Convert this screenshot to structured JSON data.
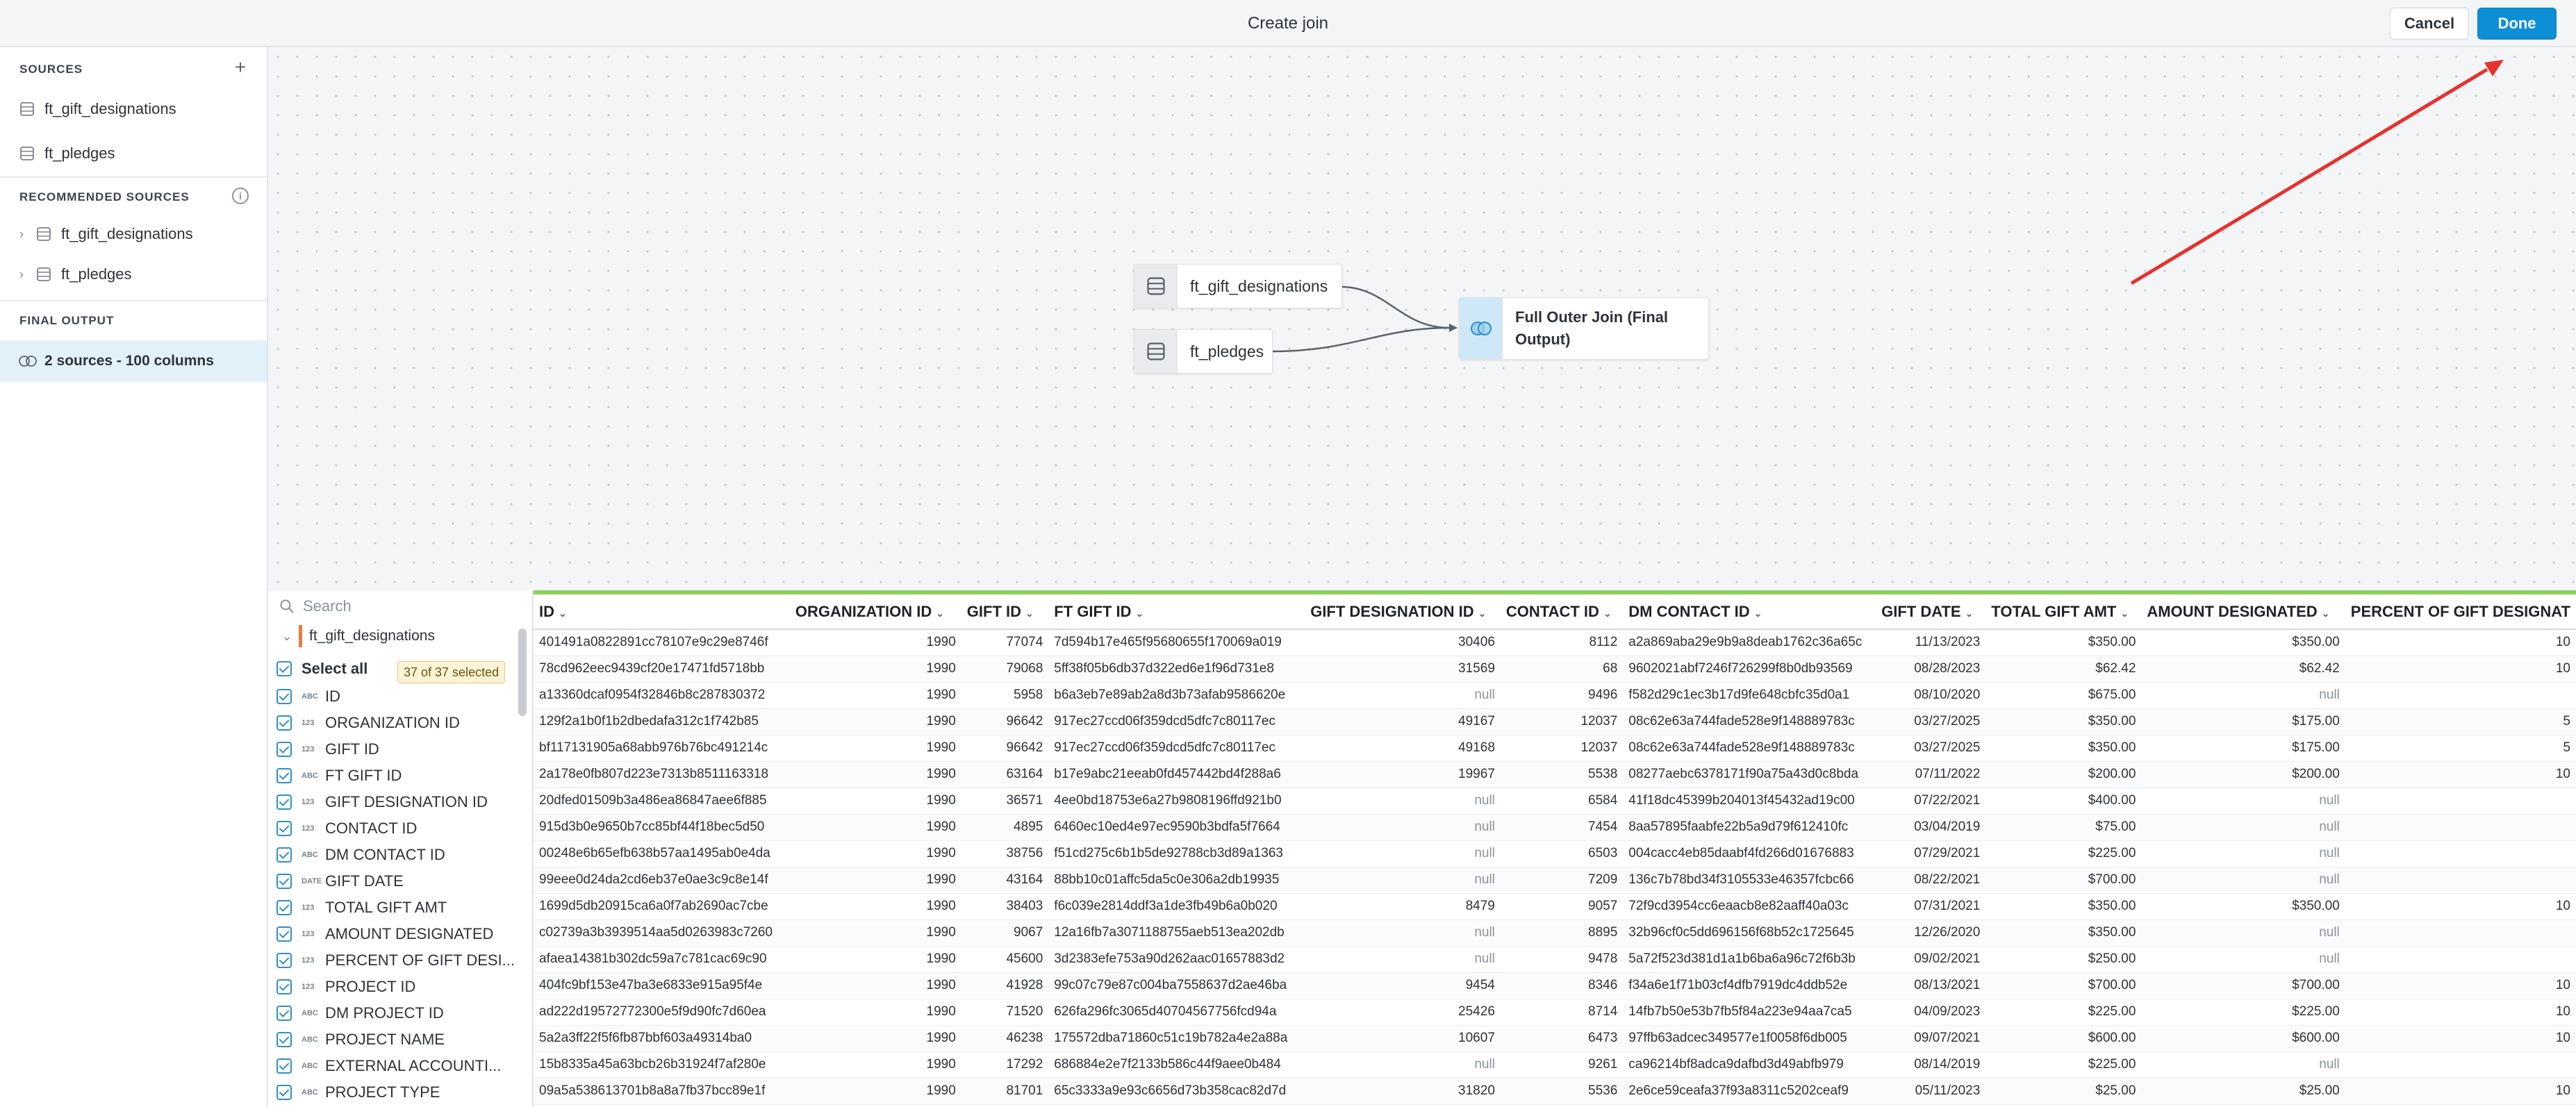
{
  "header": {
    "title": "Create join",
    "cancel_label": "Cancel",
    "done_label": "Done"
  },
  "sidebar": {
    "sources_heading": "SOURCES",
    "sources": [
      "ft_gift_designations",
      "ft_pledges"
    ],
    "recommended_heading": "RECOMMENDED SOURCES",
    "recommended": [
      "ft_gift_designations",
      "ft_pledges"
    ],
    "final_heading": "FINAL OUTPUT",
    "final_item": "2 sources - 100 columns"
  },
  "canvas": {
    "node1": "ft_gift_designations",
    "node2": "ft_pledges",
    "join_line1": "Full Outer Join (Final",
    "join_line2": "Output)"
  },
  "fields": {
    "search_placeholder": "Search",
    "source_name": "ft_gift_designations",
    "select_all": "Select all",
    "selected_badge": "37 of 37 selected",
    "items": [
      {
        "type": "ABC",
        "name": "ID"
      },
      {
        "type": "123",
        "name": "ORGANIZATION ID"
      },
      {
        "type": "123",
        "name": "GIFT ID"
      },
      {
        "type": "ABC",
        "name": "FT GIFT ID"
      },
      {
        "type": "123",
        "name": "GIFT DESIGNATION ID"
      },
      {
        "type": "123",
        "name": "CONTACT ID"
      },
      {
        "type": "ABC",
        "name": "DM CONTACT ID"
      },
      {
        "type": "DATE",
        "name": "GIFT DATE"
      },
      {
        "type": "123",
        "name": "TOTAL GIFT AMT"
      },
      {
        "type": "123",
        "name": "AMOUNT DESIGNATED"
      },
      {
        "type": "123",
        "name": "PERCENT OF GIFT DESI..."
      },
      {
        "type": "123",
        "name": "PROJECT ID"
      },
      {
        "type": "ABC",
        "name": "DM PROJECT ID"
      },
      {
        "type": "ABC",
        "name": "PROJECT NAME"
      },
      {
        "type": "ABC",
        "name": "EXTERNAL ACCOUNTI..."
      },
      {
        "type": "ABC",
        "name": "PROJECT TYPE"
      }
    ]
  },
  "table": {
    "columns": [
      "ID",
      "ORGANIZATION ID",
      "GIFT ID",
      "FT GIFT ID",
      "GIFT DESIGNATION ID",
      "CONTACT ID",
      "DM CONTACT ID",
      "GIFT DATE",
      "TOTAL GIFT AMT",
      "AMOUNT DESIGNATED",
      "PERCENT OF GIFT DESIGNAT"
    ],
    "rows": [
      [
        "401491a0822891cc78107e9c29e8746f",
        "1990",
        "77074",
        "7d594b17e465f95680655f170069a019",
        "30406",
        "8112",
        "a2a869aba29e9b9a8deab1762c36a65c",
        "11/13/2023",
        "$350.00",
        "$350.00",
        "10"
      ],
      [
        "78cd962eec9439cf20e17471fd5718bb",
        "1990",
        "79068",
        "5ff38f05b6db37d322ed6e1f96d731e8",
        "31569",
        "68",
        "9602021abf7246f726299f8b0db93569",
        "08/28/2023",
        "$62.42",
        "$62.42",
        "10"
      ],
      [
        "a13360dcaf0954f32846b8c287830372",
        "1990",
        "5958",
        "b6a3eb7e89ab2a8d3b73afab9586620e",
        "null",
        "9496",
        "f582d29c1ec3b17d9fe648cbfc35d0a1",
        "08/10/2020",
        "$675.00",
        "null",
        ""
      ],
      [
        "129f2a1b0f1b2dbedafa312c1f742b85",
        "1990",
        "96642",
        "917ec27ccd06f359dcd5dfc7c80117ec",
        "49167",
        "12037",
        "08c62e63a744fade528e9f148889783c",
        "03/27/2025",
        "$350.00",
        "$175.00",
        "5"
      ],
      [
        "bf117131905a68abb976b76bc491214c",
        "1990",
        "96642",
        "917ec27ccd06f359dcd5dfc7c80117ec",
        "49168",
        "12037",
        "08c62e63a744fade528e9f148889783c",
        "03/27/2025",
        "$350.00",
        "$175.00",
        "5"
      ],
      [
        "2a178e0fb807d223e7313b8511163318",
        "1990",
        "63164",
        "b17e9abc21eeab0fd457442bd4f288a6",
        "19967",
        "5538",
        "08277aebc6378171f90a75a43d0c8bda",
        "07/11/2022",
        "$200.00",
        "$200.00",
        "10"
      ],
      [
        "20dfed01509b3a486ea86847aee6f885",
        "1990",
        "36571",
        "4ee0bd18753e6a27b9808196ffd921b0",
        "null",
        "6584",
        "41f18dc45399b204013f45432ad19c00",
        "07/22/2021",
        "$400.00",
        "null",
        ""
      ],
      [
        "915d3b0e9650b7cc85bf44f18bec5d50",
        "1990",
        "4895",
        "6460ec10ed4e97ec9590b3bdfa5f7664",
        "null",
        "7454",
        "8aa57895faabfe22b5a9d79f612410fc",
        "03/04/2019",
        "$75.00",
        "null",
        ""
      ],
      [
        "00248e6b65efb638b57aa1495ab0e4da",
        "1990",
        "38756",
        "f51cd275c6b1b5de92788cb3d89a1363",
        "null",
        "6503",
        "004cacc4eb85daabf4fd266d01676883",
        "07/29/2021",
        "$225.00",
        "null",
        ""
      ],
      [
        "99eee0d24da2cd6eb37e0ae3c9c8e14f",
        "1990",
        "43164",
        "88bb10c01affc5da5c0e306a2db19935",
        "null",
        "7209",
        "136c7b78bd34f3105533e46357fcbc66",
        "08/22/2021",
        "$700.00",
        "null",
        ""
      ],
      [
        "1699d5db20915ca6a0f7ab2690ac7cbe",
        "1990",
        "38403",
        "f6c039e2814ddf3a1de3fb49b6a0b020",
        "8479",
        "9057",
        "72f9cd3954cc6eaacb8e82aaff40a03c",
        "07/31/2021",
        "$350.00",
        "$350.00",
        "10"
      ],
      [
        "c02739a3b3939514aa5d0263983c7260",
        "1990",
        "9067",
        "12a16fb7a3071188755aeb513ea202db",
        "null",
        "8895",
        "32b96cf0c5dd696156f68b52c1725645",
        "12/26/2020",
        "$350.00",
        "null",
        ""
      ],
      [
        "afaea14381b302dc59a7c781cac69c90",
        "1990",
        "45600",
        "3d2383efe753a90d262aac01657883d2",
        "null",
        "9478",
        "5a72f523d381d1a1b6ba6a96c72f6b3b",
        "09/02/2021",
        "$250.00",
        "null",
        ""
      ],
      [
        "404fc9bf153e47ba3e6833e915a95f4e",
        "1990",
        "41928",
        "99c07c79e87c004ba7558637d2ae46ba",
        "9454",
        "8346",
        "f34a6e1f71b03cf4dfb7919dc4ddb52e",
        "08/13/2021",
        "$700.00",
        "$700.00",
        "10"
      ],
      [
        "ad222d19572772300e5f9d90fc7d60ea",
        "1990",
        "71520",
        "626fa296fc3065d40704567756fcd94a",
        "25426",
        "8714",
        "14fb7b50e53b7fb5f84a223e94aa7ca5",
        "04/09/2023",
        "$225.00",
        "$225.00",
        "10"
      ],
      [
        "5a2a3ff22f5f6fb87bbf603a49314ba0",
        "1990",
        "46238",
        "175572dba71860c51c19b782a4e2a88a",
        "10607",
        "6473",
        "97ffb63adcec349577e1f0058f6db005",
        "09/07/2021",
        "$600.00",
        "$600.00",
        "10"
      ],
      [
        "15b8335a45a63bcb26b31924f7af280e",
        "1990",
        "17292",
        "686884e2e7f2133b586c44f9aee0b484",
        "null",
        "9261",
        "ca96214bf8adca9dafbd3d49abfb979",
        "08/14/2019",
        "$225.00",
        "null",
        ""
      ],
      [
        "09a5a538613701b8a8a7fb37bcc89e1f",
        "1990",
        "81701",
        "65c3333a9e93c6656d73b358cac82d7d",
        "31820",
        "5536",
        "2e6ce59ceafa37f93a8311c5202ceaf9",
        "05/11/2023",
        "$25.00",
        "$25.00",
        "10"
      ]
    ]
  },
  "colors": {
    "accent": "#0d8fd6",
    "annotation_arrow": "#e8302c",
    "green_bar": "#8fcf5a",
    "source_accent": "#f07a3d"
  },
  "icons": {
    "database": "database-icon",
    "join": "join-circles-icon",
    "plus": "plus-icon",
    "info": "info-icon",
    "search": "search-icon"
  }
}
